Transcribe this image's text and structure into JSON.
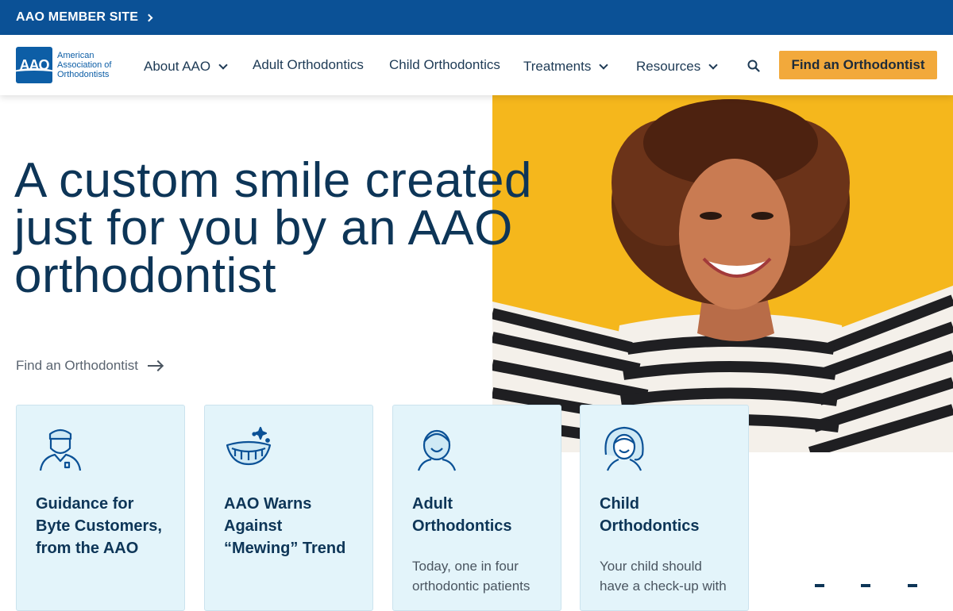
{
  "topbar": {
    "member_label": "AAO MEMBER SITE"
  },
  "logo": {
    "mark": "AAO",
    "line1": "American",
    "line2": "Association of",
    "line3": "Orthodontists"
  },
  "nav": {
    "items": [
      {
        "label": "About AAO",
        "dropdown": true
      },
      {
        "label": "Adult Orthodontics",
        "dropdown": false
      },
      {
        "label": "Child Orthodontics",
        "dropdown": false
      },
      {
        "label": "Treatments",
        "dropdown": true
      },
      {
        "label": "Resources",
        "dropdown": true
      }
    ],
    "search_icon": "search-icon",
    "cta_label": "Find an Orthodontist"
  },
  "hero": {
    "headline": "A custom smile created just for you by an AAO orthodontist",
    "link_label": "Find an Orthodontist",
    "photo_bg": "#f5b71c"
  },
  "cards": [
    {
      "icon": "orthodontist-icon",
      "title": "Guidance for Byte Customers, from the AAO",
      "text": ""
    },
    {
      "icon": "smile-sparkle-icon",
      "title": "AAO Warns Against “Mewing” Trend",
      "text": ""
    },
    {
      "icon": "adult-face-icon",
      "title": "Adult Orthodontics",
      "text": "Today, one in four orthodontic patients"
    },
    {
      "icon": "child-face-icon",
      "title": "Child Orthodontics",
      "text": "Your child should have a check-up with"
    }
  ],
  "colors": {
    "topbar": "#0b5196",
    "accent": "#f2a93b",
    "navy": "#0d3557",
    "card_bg": "#e3f4fa"
  }
}
